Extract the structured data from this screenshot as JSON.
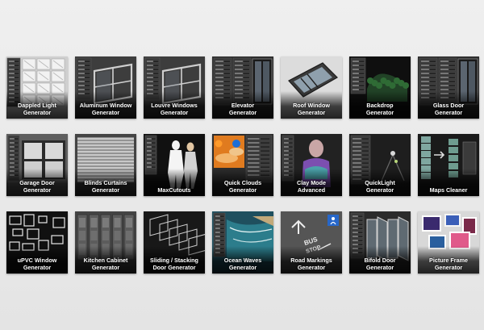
{
  "products": [
    {
      "id": "dappled-light-generator",
      "lines": [
        "Dappled Light",
        "Generator"
      ],
      "theme": "grid-white"
    },
    {
      "id": "aluminum-window-generator",
      "lines": [
        "Aluminum Window",
        "Generator"
      ],
      "theme": "window-frame"
    },
    {
      "id": "louvre-windows-generator",
      "lines": [
        "Louvre Windows",
        "Generator"
      ],
      "theme": "window-frame"
    },
    {
      "id": "elevator-generator",
      "lines": [
        "Elevator",
        "Generator"
      ],
      "theme": "panel-ui"
    },
    {
      "id": "roof-window-generator",
      "lines": [
        "Roof Window",
        "Generator"
      ],
      "theme": "roof"
    },
    {
      "id": "backdrop-generator",
      "lines": [
        "Backdrop",
        "Generator"
      ],
      "theme": "backdrop"
    },
    {
      "id": "glass-door-generator",
      "lines": [
        "Glass Door",
        "Generator"
      ],
      "theme": "panel-ui"
    },
    {
      "id": "garage-door-generator",
      "lines": [
        "Garage Door",
        "Generator"
      ],
      "theme": "garage"
    },
    {
      "id": "blinds-curtains-generator",
      "lines": [
        "Blinds Curtains",
        "Generator"
      ],
      "theme": "blinds"
    },
    {
      "id": "maxcutouts",
      "lines": [
        "MaxCutouts"
      ],
      "theme": "cutouts"
    },
    {
      "id": "quick-clouds-generator",
      "lines": [
        "Quick Clouds",
        "Generator"
      ],
      "theme": "clouds"
    },
    {
      "id": "clay-mode-advanced",
      "lines": [
        "Clay Mode",
        "Advanced"
      ],
      "theme": "clay"
    },
    {
      "id": "quicklight-generator",
      "lines": [
        "QuickLight",
        "Generator"
      ],
      "theme": "light"
    },
    {
      "id": "maps-cleaner",
      "lines": [
        "Maps Cleaner"
      ],
      "theme": "maps"
    },
    {
      "id": "upvc-window-generator",
      "lines": [
        "uPVC Window",
        "Generator"
      ],
      "theme": "upvc"
    },
    {
      "id": "kitchen-cabinet-generator",
      "lines": [
        "Kitchen Cabinet",
        "Generator"
      ],
      "theme": "kitchen"
    },
    {
      "id": "sliding-stacking-door-generator",
      "lines": [
        "Sliding / Stacking",
        "Door Generator"
      ],
      "theme": "sliding"
    },
    {
      "id": "ocean-waves-generator",
      "lines": [
        "Ocean Waves",
        "Generator"
      ],
      "theme": "ocean"
    },
    {
      "id": "road-markings-generator",
      "lines": [
        "Road Markings",
        "Generator"
      ],
      "theme": "road"
    },
    {
      "id": "bifold-door-generator",
      "lines": [
        "Bifold Door",
        "Generator"
      ],
      "theme": "bifold"
    },
    {
      "id": "picture-frame-generator",
      "lines": [
        "Picture Frame",
        "Generator"
      ],
      "theme": "frames"
    }
  ],
  "road_marking_words": [
    "BUS",
    "STOP"
  ]
}
